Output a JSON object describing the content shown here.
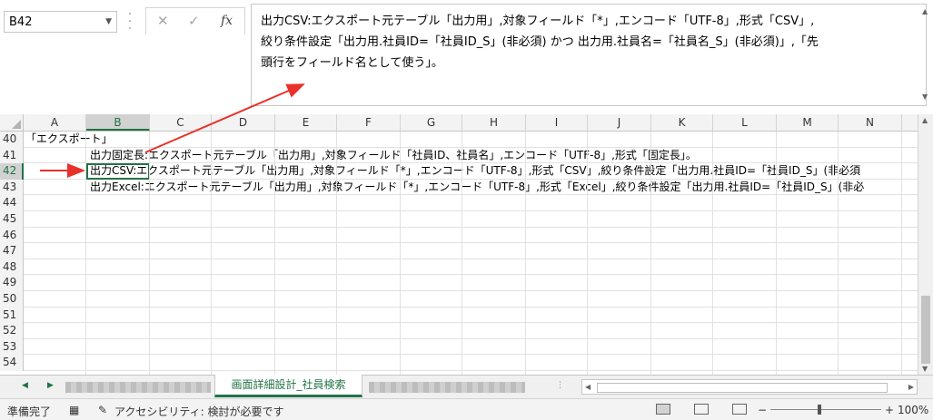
{
  "name_box": {
    "value": "B42"
  },
  "formula_bar": {
    "cancel_icon": "✕",
    "enter_icon": "✓",
    "fx_label": "fx",
    "content": "出力CSV:エクスポート元テーブル「出力用」,対象フィールド「*」,エンコード「UTF-8」,形式「CSV」,\n絞り条件設定「出力用.社員ID=「社員ID_S」(非必須) かつ 出力用.社員名=「社員名_S」(非必須)」,「先\n頭行をフィールド名として使う」。"
  },
  "columns": [
    "A",
    "B",
    "C",
    "D",
    "E",
    "F",
    "G",
    "H",
    "I",
    "J",
    "K",
    "L",
    "M",
    "N"
  ],
  "selected_column": "B",
  "rows": [
    {
      "num": "40",
      "text": "「エクスポート」",
      "col": "A"
    },
    {
      "num": "41",
      "text": "出力固定長:エクスポート元テーブル「出力用」,対象フィールド「社員ID、社員名」,エンコード「UTF-8」,形式「固定長」。",
      "col": "B"
    },
    {
      "num": "42",
      "text": "出力CSV:エクスポート元テーブル「出力用」,対象フィールド「*」,エンコード「UTF-8」,形式「CSV」,絞り条件設定「出力用.社員ID=「社員ID_S」(非必須",
      "col": "B"
    },
    {
      "num": "43",
      "text": "出力Excel:エクスポート元テーブル「出力用」,対象フィールド「*」,エンコード「UTF-8」,形式「Excel」,絞り条件設定「出力用.社員ID=「社員ID_S」(非必",
      "col": "B"
    },
    {
      "num": "44",
      "text": "",
      "col": "B"
    },
    {
      "num": "45",
      "text": "",
      "col": "B"
    },
    {
      "num": "46",
      "text": "",
      "col": "B"
    },
    {
      "num": "47",
      "text": "",
      "col": "B"
    },
    {
      "num": "48",
      "text": "",
      "col": "B"
    },
    {
      "num": "49",
      "text": "",
      "col": "B"
    },
    {
      "num": "50",
      "text": "",
      "col": "B"
    },
    {
      "num": "51",
      "text": "",
      "col": "B"
    },
    {
      "num": "52",
      "text": "",
      "col": "B"
    },
    {
      "num": "53",
      "text": "",
      "col": "B"
    },
    {
      "num": "54",
      "text": "",
      "col": "B"
    }
  ],
  "selected_row": "42",
  "sheet_tabs": {
    "active": "画面詳細設計_社員検索"
  },
  "status_bar": {
    "ready": "準備完了",
    "accessibility": "アクセシビリティ: 検討が必要です",
    "zoom": "100%",
    "zoom_minus": "−",
    "zoom_plus": "+"
  },
  "colors": {
    "accent": "#217346",
    "arrow": "#e8312a"
  }
}
